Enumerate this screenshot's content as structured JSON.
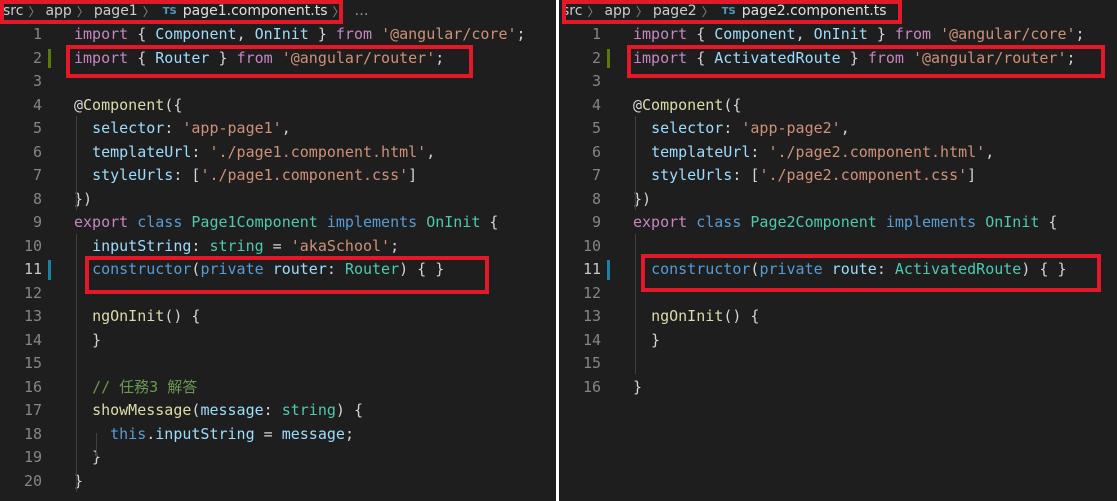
{
  "left": {
    "breadcrumb": {
      "src": "src",
      "app": "app",
      "folder": "page1",
      "file_badge": "TS",
      "file": "page1.component.ts",
      "more": "…"
    },
    "lines": [
      {
        "n": "1",
        "tokens": [
          [
            "ki",
            "import"
          ],
          [
            "p",
            " { "
          ],
          [
            "v",
            "Component"
          ],
          [
            "p",
            ", "
          ],
          [
            "v",
            "OnInit"
          ],
          [
            "p",
            " } "
          ],
          [
            "ki",
            "from"
          ],
          [
            "p",
            " "
          ],
          [
            "s",
            "'@angular/core'"
          ],
          [
            "p",
            ";"
          ]
        ]
      },
      {
        "n": "2",
        "tokens": [
          [
            "ki",
            "import"
          ],
          [
            "p",
            " { "
          ],
          [
            "v",
            "Router"
          ],
          [
            "p",
            " } "
          ],
          [
            "ki",
            "from"
          ],
          [
            "p",
            " "
          ],
          [
            "s",
            "'@angular/router'"
          ],
          [
            "p",
            ";"
          ]
        ]
      },
      {
        "n": "3",
        "tokens": []
      },
      {
        "n": "4",
        "tokens": [
          [
            "p",
            "@"
          ],
          [
            "f",
            "Component"
          ],
          [
            "p",
            "({"
          ]
        ]
      },
      {
        "n": "5",
        "tokens": [
          [
            "p",
            "  "
          ],
          [
            "v",
            "selector"
          ],
          [
            "p",
            ": "
          ],
          [
            "s",
            "'app-page1'"
          ],
          [
            "p",
            ","
          ]
        ]
      },
      {
        "n": "6",
        "tokens": [
          [
            "p",
            "  "
          ],
          [
            "v",
            "templateUrl"
          ],
          [
            "p",
            ": "
          ],
          [
            "s",
            "'./page1.component.html'"
          ],
          [
            "p",
            ","
          ]
        ]
      },
      {
        "n": "7",
        "tokens": [
          [
            "p",
            "  "
          ],
          [
            "v",
            "styleUrls"
          ],
          [
            "p",
            ": ["
          ],
          [
            "s",
            "'./page1.component.css'"
          ],
          [
            "p",
            "]"
          ]
        ]
      },
      {
        "n": "8",
        "tokens": [
          [
            "p",
            "})"
          ]
        ]
      },
      {
        "n": "9",
        "tokens": [
          [
            "ki",
            "export"
          ],
          [
            "p",
            " "
          ],
          [
            "k",
            "class"
          ],
          [
            "p",
            " "
          ],
          [
            "t",
            "Page1Component"
          ],
          [
            "p",
            " "
          ],
          [
            "k",
            "implements"
          ],
          [
            "p",
            " "
          ],
          [
            "t",
            "OnInit"
          ],
          [
            "p",
            " {"
          ]
        ]
      },
      {
        "n": "10",
        "tokens": [
          [
            "p",
            "  "
          ],
          [
            "v",
            "inputString"
          ],
          [
            "p",
            ": "
          ],
          [
            "t",
            "string"
          ],
          [
            "p",
            " = "
          ],
          [
            "s",
            "'akaSchool'"
          ],
          [
            "p",
            ";"
          ]
        ]
      },
      {
        "n": "11",
        "tokens": [
          [
            "p",
            "  "
          ],
          [
            "k",
            "constructor"
          ],
          [
            "p",
            "("
          ],
          [
            "k",
            "private"
          ],
          [
            "p",
            " "
          ],
          [
            "v",
            "router"
          ],
          [
            "p",
            ": "
          ],
          [
            "t",
            "Router"
          ],
          [
            "p",
            ") { }"
          ]
        ]
      },
      {
        "n": "12",
        "tokens": []
      },
      {
        "n": "13",
        "tokens": [
          [
            "p",
            "  "
          ],
          [
            "f",
            "ngOnInit"
          ],
          [
            "p",
            "() {"
          ]
        ]
      },
      {
        "n": "14",
        "tokens": [
          [
            "p",
            "  }"
          ]
        ]
      },
      {
        "n": "15",
        "tokens": []
      },
      {
        "n": "16",
        "tokens": [
          [
            "p",
            "  "
          ],
          [
            "c",
            "// 任務3 解答"
          ]
        ]
      },
      {
        "n": "17",
        "tokens": [
          [
            "p",
            "  "
          ],
          [
            "f",
            "showMessage"
          ],
          [
            "p",
            "("
          ],
          [
            "v",
            "message"
          ],
          [
            "p",
            ": "
          ],
          [
            "t",
            "string"
          ],
          [
            "p",
            ") {"
          ]
        ]
      },
      {
        "n": "18",
        "tokens": [
          [
            "p",
            "    "
          ],
          [
            "k",
            "this"
          ],
          [
            "p",
            "."
          ],
          [
            "v",
            "inputString"
          ],
          [
            "p",
            " = "
          ],
          [
            "v",
            "message"
          ],
          [
            "p",
            ";"
          ]
        ]
      },
      {
        "n": "19",
        "tokens": [
          [
            "p",
            "  }"
          ]
        ]
      },
      {
        "n": "20",
        "tokens": [
          [
            "p",
            "}"
          ]
        ]
      }
    ]
  },
  "right": {
    "breadcrumb": {
      "src": "src",
      "app": "app",
      "folder": "page2",
      "file_badge": "TS",
      "file": "page2.component.ts"
    },
    "lines": [
      {
        "n": "1",
        "tokens": [
          [
            "ki",
            "import"
          ],
          [
            "p",
            " { "
          ],
          [
            "v",
            "Component"
          ],
          [
            "p",
            ", "
          ],
          [
            "v",
            "OnInit"
          ],
          [
            "p",
            " } "
          ],
          [
            "ki",
            "from"
          ],
          [
            "p",
            " "
          ],
          [
            "s",
            "'@angular/core'"
          ],
          [
            "p",
            ";"
          ]
        ]
      },
      {
        "n": "2",
        "tokens": [
          [
            "ki",
            "import"
          ],
          [
            "p",
            " { "
          ],
          [
            "v",
            "ActivatedRoute"
          ],
          [
            "p",
            " } "
          ],
          [
            "ki",
            "from"
          ],
          [
            "p",
            " "
          ],
          [
            "s",
            "'@angular/router'"
          ],
          [
            "p",
            ";"
          ]
        ]
      },
      {
        "n": "3",
        "tokens": []
      },
      {
        "n": "4",
        "tokens": [
          [
            "p",
            "@"
          ],
          [
            "f",
            "Component"
          ],
          [
            "p",
            "({"
          ]
        ]
      },
      {
        "n": "5",
        "tokens": [
          [
            "p",
            "  "
          ],
          [
            "v",
            "selector"
          ],
          [
            "p",
            ": "
          ],
          [
            "s",
            "'app-page2'"
          ],
          [
            "p",
            ","
          ]
        ]
      },
      {
        "n": "6",
        "tokens": [
          [
            "p",
            "  "
          ],
          [
            "v",
            "templateUrl"
          ],
          [
            "p",
            ": "
          ],
          [
            "s",
            "'./page2.component.html'"
          ],
          [
            "p",
            ","
          ]
        ]
      },
      {
        "n": "7",
        "tokens": [
          [
            "p",
            "  "
          ],
          [
            "v",
            "styleUrls"
          ],
          [
            "p",
            ": ["
          ],
          [
            "s",
            "'./page2.component.css'"
          ],
          [
            "p",
            "]"
          ]
        ]
      },
      {
        "n": "8",
        "tokens": [
          [
            "p",
            "})"
          ]
        ]
      },
      {
        "n": "9",
        "tokens": [
          [
            "ki",
            "export"
          ],
          [
            "p",
            " "
          ],
          [
            "k",
            "class"
          ],
          [
            "p",
            " "
          ],
          [
            "t",
            "Page2Component"
          ],
          [
            "p",
            " "
          ],
          [
            "k",
            "implements"
          ],
          [
            "p",
            " "
          ],
          [
            "t",
            "OnInit"
          ],
          [
            "p",
            " {"
          ]
        ]
      },
      {
        "n": "10",
        "tokens": []
      },
      {
        "n": "11",
        "tokens": [
          [
            "p",
            "  "
          ],
          [
            "k",
            "constructor"
          ],
          [
            "p",
            "("
          ],
          [
            "k",
            "private"
          ],
          [
            "p",
            " "
          ],
          [
            "v",
            "route"
          ],
          [
            "p",
            ": "
          ],
          [
            "t",
            "ActivatedRoute"
          ],
          [
            "p",
            ") { }"
          ]
        ]
      },
      {
        "n": "12",
        "tokens": []
      },
      {
        "n": "13",
        "tokens": [
          [
            "p",
            "  "
          ],
          [
            "f",
            "ngOnInit"
          ],
          [
            "p",
            "() {"
          ]
        ]
      },
      {
        "n": "14",
        "tokens": [
          [
            "p",
            "  }"
          ]
        ]
      },
      {
        "n": "15",
        "tokens": []
      },
      {
        "n": "16",
        "tokens": [
          [
            "p",
            "}"
          ]
        ]
      }
    ]
  },
  "colors": {
    "editor_bg": "#1e1e1e",
    "highlight_box": "#e3192a",
    "modified_gutter": "#587c0c",
    "changed_gutter": "#1b81a8"
  }
}
